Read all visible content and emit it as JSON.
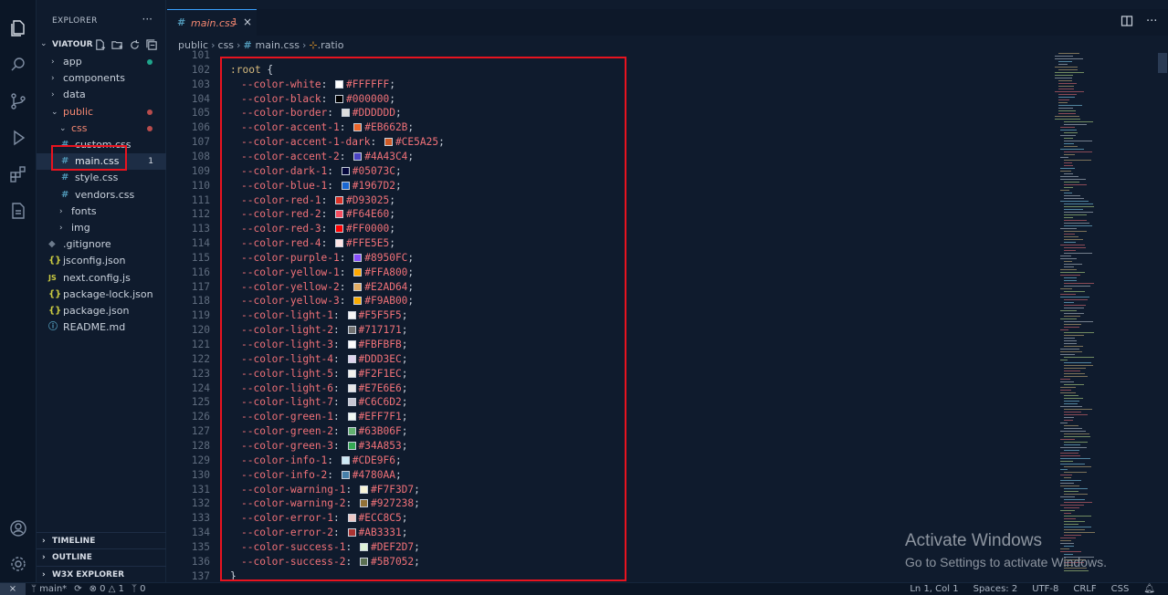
{
  "sidebar": {
    "title": "EXPLORER",
    "more_icon": "ellipsis-icon",
    "project": "VIATOUR",
    "tree": [
      {
        "label": "app",
        "type": "folder",
        "open": false,
        "depth": 1,
        "dot": "#1fa58c"
      },
      {
        "label": "components",
        "type": "folder",
        "open": false,
        "depth": 1
      },
      {
        "label": "data",
        "type": "folder",
        "open": false,
        "depth": 1
      },
      {
        "label": "public",
        "type": "folder",
        "open": true,
        "depth": 1,
        "dot": "#b84c4c",
        "error": true
      },
      {
        "label": "css",
        "type": "folder",
        "open": true,
        "depth": 2,
        "dot": "#b84c4c",
        "error": true
      },
      {
        "label": "custom.css",
        "type": "css",
        "depth": 3
      },
      {
        "label": "main.css",
        "type": "css",
        "depth": 3,
        "selected": true,
        "badge": "1"
      },
      {
        "label": "style.css",
        "type": "css",
        "depth": 3
      },
      {
        "label": "vendors.css",
        "type": "css",
        "depth": 3
      },
      {
        "label": "fonts",
        "type": "folder",
        "open": false,
        "depth": 2
      },
      {
        "label": "img",
        "type": "folder",
        "open": false,
        "depth": 2
      },
      {
        "label": ".gitignore",
        "type": "git",
        "depth": 1
      },
      {
        "label": "jsconfig.json",
        "type": "json",
        "depth": 1
      },
      {
        "label": "next.config.js",
        "type": "js",
        "depth": 1
      },
      {
        "label": "package-lock.json",
        "type": "json",
        "depth": 1
      },
      {
        "label": "package.json",
        "type": "json",
        "depth": 1
      },
      {
        "label": "README.md",
        "type": "info",
        "depth": 1
      }
    ],
    "sections": [
      "TIMELINE",
      "OUTLINE",
      "W3X EXPLORER"
    ]
  },
  "tab": {
    "label": "main.css",
    "problems": "1",
    "close": "×"
  },
  "breadcrumb": [
    "public",
    "css",
    "main.css",
    ".ratio"
  ],
  "code": {
    "selector_line": {
      "num": "102",
      "text": ":root",
      "brace": " {"
    },
    "prefix_line": {
      "num": "101"
    },
    "vars": [
      {
        "num": "103",
        "name": "--color-white",
        "value": "#FFFFFF"
      },
      {
        "num": "104",
        "name": "--color-black",
        "value": "#000000"
      },
      {
        "num": "105",
        "name": "--color-border",
        "value": "#DDDDDD"
      },
      {
        "num": "106",
        "name": "--color-accent-1",
        "value": "#EB662B"
      },
      {
        "num": "107",
        "name": "--color-accent-1-dark",
        "value": "#CE5A25"
      },
      {
        "num": "108",
        "name": "--color-accent-2",
        "value": "#4A43C4"
      },
      {
        "num": "109",
        "name": "--color-dark-1",
        "value": "#05073C"
      },
      {
        "num": "110",
        "name": "--color-blue-1",
        "value": "#1967D2"
      },
      {
        "num": "111",
        "name": "--color-red-1",
        "value": "#D93025"
      },
      {
        "num": "112",
        "name": "--color-red-2",
        "value": "#F64E60"
      },
      {
        "num": "113",
        "name": "--color-red-3",
        "value": "#FF0000"
      },
      {
        "num": "114",
        "name": "--color-red-4",
        "value": "#FFE5E5"
      },
      {
        "num": "115",
        "name": "--color-purple-1",
        "value": "#8950FC"
      },
      {
        "num": "116",
        "name": "--color-yellow-1",
        "value": "#FFA800"
      },
      {
        "num": "117",
        "name": "--color-yellow-2",
        "value": "#E2AD64"
      },
      {
        "num": "118",
        "name": "--color-yellow-3",
        "value": "#F9AB00"
      },
      {
        "num": "119",
        "name": "--color-light-1",
        "value": "#F5F5F5"
      },
      {
        "num": "120",
        "name": "--color-light-2",
        "value": "#717171"
      },
      {
        "num": "121",
        "name": "--color-light-3",
        "value": "#FBFBFB"
      },
      {
        "num": "122",
        "name": "--color-light-4",
        "value": "#DDD3EC"
      },
      {
        "num": "123",
        "name": "--color-light-5",
        "value": "#F2F1EC"
      },
      {
        "num": "124",
        "name": "--color-light-6",
        "value": "#E7E6E6"
      },
      {
        "num": "125",
        "name": "--color-light-7",
        "value": "#C6C6D2"
      },
      {
        "num": "126",
        "name": "--color-green-1",
        "value": "#EFF7F1"
      },
      {
        "num": "127",
        "name": "--color-green-2",
        "value": "#63B06F"
      },
      {
        "num": "128",
        "name": "--color-green-3",
        "value": "#34A853"
      },
      {
        "num": "129",
        "name": "--color-info-1",
        "value": "#CDE9F6"
      },
      {
        "num": "130",
        "name": "--color-info-2",
        "value": "#4780AA"
      },
      {
        "num": "131",
        "name": "--color-warning-1",
        "value": "#F7F3D7"
      },
      {
        "num": "132",
        "name": "--color-warning-2",
        "value": "#927238"
      },
      {
        "num": "133",
        "name": "--color-error-1",
        "value": "#ECC8C5"
      },
      {
        "num": "134",
        "name": "--color-error-2",
        "value": "#AB3331"
      },
      {
        "num": "135",
        "name": "--color-success-1",
        "value": "#DEF2D7"
      },
      {
        "num": "136",
        "name": "--color-success-2",
        "value": "#5B7052"
      }
    ],
    "closing_line": {
      "num": "137",
      "text": "}"
    }
  },
  "watermark": {
    "title": "Activate Windows",
    "subtitle": "Go to Settings to activate Windows."
  },
  "status": {
    "branch": "main*",
    "errors": "0",
    "warnings": "1",
    "ports": "0",
    "cursor": "Ln 1, Col 1",
    "spaces": "Spaces: 2",
    "encoding": "UTF-8",
    "eol": "CRLF",
    "language": "CSS"
  },
  "colors": {
    "accent": "#3aa0ff",
    "highlight_box": "#e8131f",
    "background": "#0f1b2d"
  }
}
